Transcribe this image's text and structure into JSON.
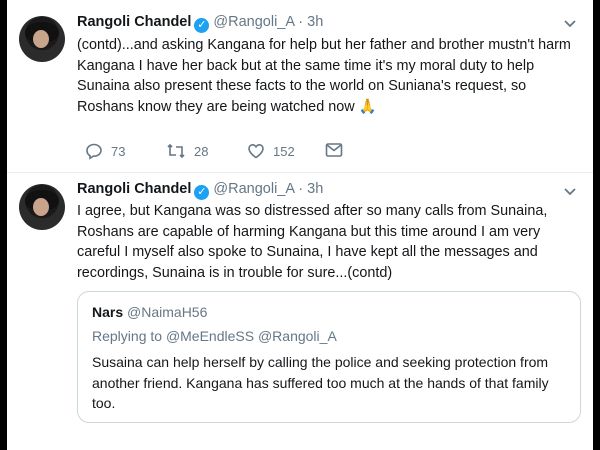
{
  "tweets": [
    {
      "name": "Rangoli Chandel",
      "handle": "@Rangoli_A",
      "dot": "·",
      "time": "3h",
      "text": "(contd)...and  asking Kangana for help but her father and brother mustn't harm Kangana I have her back but at the same time it's my moral duty to help Sunaina also present these facts to the world on Suniana's request, so Roshans know they are being watched now 🙏",
      "replies": "73",
      "retweets": "28",
      "likes": "152"
    },
    {
      "name": "Rangoli Chandel",
      "handle": "@Rangoli_A",
      "dot": "·",
      "time": "3h",
      "text": "I agree, but Kangana was so distressed after so many calls from Sunaina, Roshans are capable of harming Kangana but this time around I am very careful I myself also spoke to Sunaina, I have kept all the messages and recordings, Sunaina is in trouble for sure...(contd)",
      "quote": {
        "name": "Nars",
        "handle": "@NaimaH56",
        "replying_prefix": "Replying to",
        "replying_to": "@MeEndleSS @Rangoli_A",
        "text": "Susaina can help herself by calling the police and seeking protection from another friend. Kangana has suffered too much at the hands of that family too."
      }
    }
  ],
  "colors": {
    "verified": "#1da1f2",
    "secondary_text": "#657786",
    "divider": "#e6ecf0"
  },
  "icons": [
    "verified-badge-icon",
    "chevron-down-icon",
    "reply-icon",
    "retweet-icon",
    "like-icon",
    "dm-icon"
  ]
}
